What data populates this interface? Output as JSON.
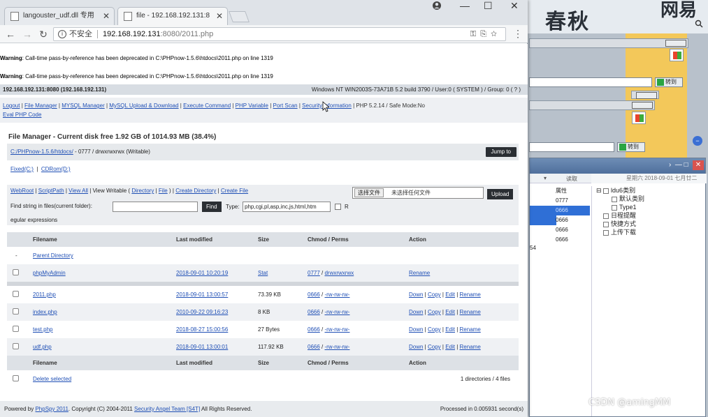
{
  "browser": {
    "tabs": [
      {
        "title": "langouster_udf.dll 专用"
      },
      {
        "title": "file - 192.168.192.131:8"
      }
    ],
    "omnibox": {
      "security": "不安全",
      "url_host": "192.168.192.131",
      "url_rest": ":8080/2011.php"
    }
  },
  "warnings": [
    {
      "label": "Warning",
      "text": ": Call-time pass-by-reference has been deprecated in C:\\PHPnow-1.5.6\\htdocs\\2011.php on line 1319"
    },
    {
      "label": "Warning",
      "text": ": Call-time pass-by-reference has been deprecated in C:\\PHPnow-1.5.6\\htdocs\\2011.php on line 1319"
    }
  ],
  "infobar": {
    "host": "192.168.192.131:8080 (192.168.192.131)",
    "system": "Windows NT WIN2003S-73A71B 5.2 build 3790 / User:0 ( SYSTEM ) / Group: 0 ( ? )"
  },
  "menu": {
    "items": [
      "Logout",
      "File Manager",
      "MYSQL Manager",
      "MySQL Upload & Download",
      "Execute Command",
      "PHP Variable",
      "Port Scan",
      "Security information"
    ],
    "php_info": "PHP 5.2.14 / Safe Mode:No",
    "eval": "Eval PHP Code"
  },
  "file_manager": {
    "title": "File Manager - Current disk free 1.92 GB of 1014.93 MB (38.4%)",
    "path": "C:/PHPnow-1.5.6/htdocs/",
    "path_perm": " - 0777 / drwxrwxrwx (Writable)",
    "jump_label": "Jump to",
    "drives": [
      {
        "label": "Fixed(C:)"
      },
      {
        "label": "CDRom(D:)"
      }
    ],
    "actions": {
      "webroot": "WebRoot",
      "scriptpath": "ScriptPath",
      "view_all": "View All",
      "view_writable": "View Writable (",
      "directory": "Directory",
      "file": "File",
      "close_paren": ")",
      "create_dir": "Create Directory",
      "create_file": "Create File"
    },
    "upload": {
      "choose_btn": "选择文件",
      "no_file": "未选择任何文件",
      "upload_label": "Upload"
    },
    "find": {
      "label": "Find string in files(current folder):",
      "find_btn": "Find",
      "type_label": "Type:",
      "type_value": "php,cgi,pl,asp,inc,js,html,htm",
      "regex_r": "R",
      "regex_rest": "egular expressions"
    },
    "columns": [
      "Filename",
      "Last modified",
      "Size",
      "Chmod / Perms",
      "Action"
    ],
    "parent_dir": "Parent Directory",
    "dirs": [
      {
        "name": "phpMyAdmin",
        "modified": "2018-09-01 10:20:19",
        "size": "Stat",
        "chmod": "0777",
        "perms": "drwxrwxrwx",
        "action": "Rename"
      }
    ],
    "files": [
      {
        "name": "2011.php",
        "modified": "2018-09-01 13:00:57",
        "size": "73.39 KB",
        "chmod": "0666",
        "perms": "-rw-rw-rw-"
      },
      {
        "name": "index.php",
        "modified": "2010-09-22 09:16:23",
        "size": "8 KB",
        "chmod": "0666",
        "perms": "-rw-rw-rw-"
      },
      {
        "name": "test.php",
        "modified": "2018-08-27 15:00:56",
        "size": "27 Bytes",
        "chmod": "0666",
        "perms": "-rw-rw-rw-"
      },
      {
        "name": "udf.php",
        "modified": "2018-09-01 13:00:01",
        "size": "117.92 KB",
        "chmod": "0666",
        "perms": "-rw-rw-rw-"
      }
    ],
    "file_actions": [
      "Down",
      "Copy",
      "Edit",
      "Rename"
    ],
    "delete_selected": "Delete selected",
    "summary": "1 directories / 4 files"
  },
  "footer": {
    "powered": "Powered by ",
    "phpspy": "PhpSpy 2011",
    "copyright": ". Copyright (C) 2004-2011 ",
    "team": "Security Angel Team [S4T]",
    "rights": " All Rights Reserved.",
    "processed": "Processed in 0.005931 second(s)"
  },
  "background": {
    "brand": "春秋",
    "brand2": "网易",
    "go_label": "转到",
    "explorer": {
      "title": "星期六 2018-09-01 七月廿二",
      "header_left": "读取",
      "header_attr": "属性",
      "rows": [
        "0777",
        "0666",
        "0666",
        "0666",
        "0666"
      ],
      "left_label": "54",
      "tree": [
        "ldu6类别",
        "默认类别",
        "Type1",
        "日程提醒",
        "快捷方式",
        "上传下载"
      ]
    }
  },
  "watermark": "CSDN @amingMM",
  "colors": {
    "link": "#1f4fb5",
    "dark_button": "#2a2e33",
    "selection": "#2f6fd6"
  }
}
